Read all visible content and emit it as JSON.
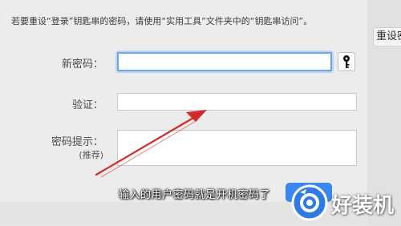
{
  "notice": "若要重设“登录”钥匙串的密码，请使用“实用工具”文件夹中的“钥匙串访问”。",
  "right_panel": {
    "tab_label": "重设密"
  },
  "form": {
    "new_password_label": "新密码：",
    "new_password_value": "",
    "verify_label": "验证：",
    "verify_value": "",
    "hint_label": "密码提示：",
    "hint_sublabel": "(推荐)",
    "hint_value": ""
  },
  "overlay": {
    "caption": "输入的用户密码就是开机密码了",
    "watermark": "好装机"
  },
  "colors": {
    "focus_ring": "#6aa7ee",
    "arrow": "#d22a2a",
    "brand_blue": "#3b86f0"
  }
}
